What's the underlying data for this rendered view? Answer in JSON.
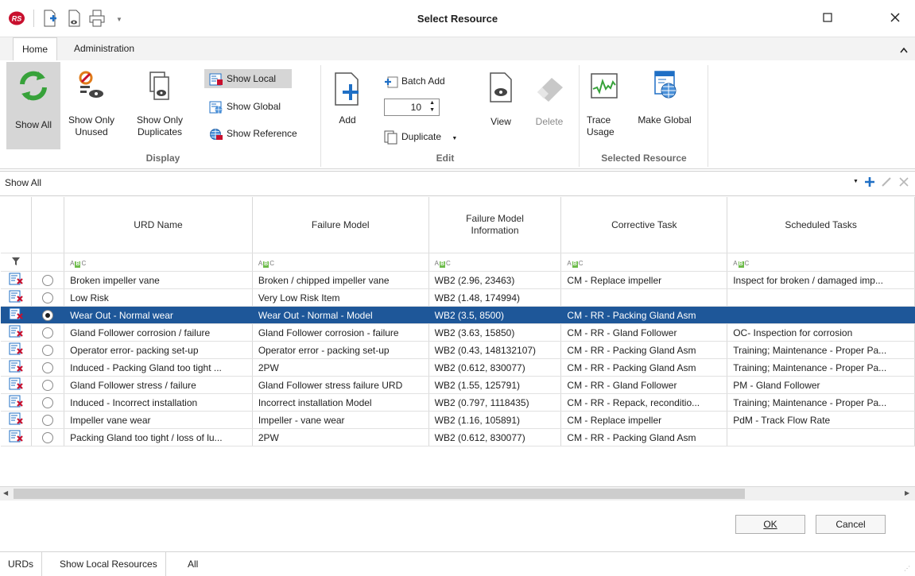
{
  "window": {
    "title": "Select Resource",
    "app_badge": "RS"
  },
  "ribbon": {
    "tabs": [
      {
        "label": "Home"
      },
      {
        "label": "Administration"
      }
    ],
    "display": {
      "group_label": "Display",
      "show_all": "Show All",
      "show_only_unused": [
        "Show Only",
        "Unused"
      ],
      "show_only_duplicates": [
        "Show Only",
        "Duplicates"
      ],
      "show_local": "Show Local",
      "show_global": "Show Global",
      "show_reference": "Show Reference"
    },
    "edit": {
      "group_label": "Edit",
      "add": "Add",
      "batch_add": "Batch Add",
      "batch_count": "10",
      "duplicate": "Duplicate",
      "view": "View",
      "delete": "Delete"
    },
    "selected_resource": {
      "group_label": "Selected Resource",
      "trace_usage": [
        "Trace",
        "Usage"
      ],
      "make_global": "Make Global"
    }
  },
  "filter": {
    "value": "Show All"
  },
  "grid": {
    "columns": [
      "URD Name",
      "Failure Model",
      "Failure Model Information",
      "Corrective Task",
      "Scheduled Tasks"
    ],
    "rows": [
      {
        "name": "Broken impeller vane",
        "model": "Broken / chipped impeller vane",
        "info": "WB2 (2.96, 23463)",
        "corrective": "CM - Replace impeller",
        "scheduled": "Inspect for broken / damaged imp..."
      },
      {
        "name": "Low Risk",
        "model": "Very Low Risk Item",
        "info": "WB2 (1.48, 174994)",
        "corrective": "",
        "scheduled": ""
      },
      {
        "name": "Wear Out - Normal wear",
        "model": "Wear Out - Normal - Model",
        "info": "WB2 (3.5, 8500)",
        "corrective": "CM - RR - Packing Gland Asm",
        "scheduled": ""
      },
      {
        "name": "Gland Follower corrosion / failure",
        "model": "Gland Follower corrosion - failure",
        "info": "WB2 (3.63, 15850)",
        "corrective": "CM - RR - Gland Follower",
        "scheduled": "OC- Inspection for corrosion"
      },
      {
        "name": "Operator error- packing set-up",
        "model": "Operator error - packing set-up",
        "info": "WB2 (0.43, 148132107)",
        "corrective": "CM - RR - Packing Gland Asm",
        "scheduled": "Training; Maintenance - Proper Pa..."
      },
      {
        "name": "Induced - Packing Gland too tight ...",
        "model": "2PW",
        "info": "WB2 (0.612, 830077)",
        "corrective": "CM - RR - Packing Gland Asm",
        "scheduled": "Training; Maintenance - Proper Pa..."
      },
      {
        "name": "Gland Follower stress / failure",
        "model": "Gland Follower stress failure URD",
        "info": "WB2 (1.55, 125791)",
        "corrective": "CM - RR - Gland Follower",
        "scheduled": "PM - Gland Follower"
      },
      {
        "name": "Induced - Incorrect installation",
        "model": "Incorrect installation Model",
        "info": "WB2 (0.797, 1118435)",
        "corrective": "CM - RR - Repack, reconditio...",
        "scheduled": "Training; Maintenance - Proper Pa..."
      },
      {
        "name": "Impeller vane wear",
        "model": "Impeller - vane wear",
        "info": "WB2 (1.16, 105891)",
        "corrective": "CM - Replace impeller",
        "scheduled": "PdM - Track Flow Rate"
      },
      {
        "name": "Packing Gland too tight / loss of lu...",
        "model": "2PW",
        "info": "WB2 (0.612, 830077)",
        "corrective": "CM - RR - Packing Gland Asm",
        "scheduled": ""
      }
    ],
    "selected_index": 2
  },
  "buttons": {
    "ok": "OK",
    "cancel": "Cancel"
  },
  "status": {
    "items": [
      "URDs",
      "Show Local Resources",
      "All"
    ]
  },
  "colors": {
    "selection": "#1e5799",
    "accent_blue": "#1f6fc5",
    "green": "#37a23a",
    "orange": "#e07b1a"
  }
}
